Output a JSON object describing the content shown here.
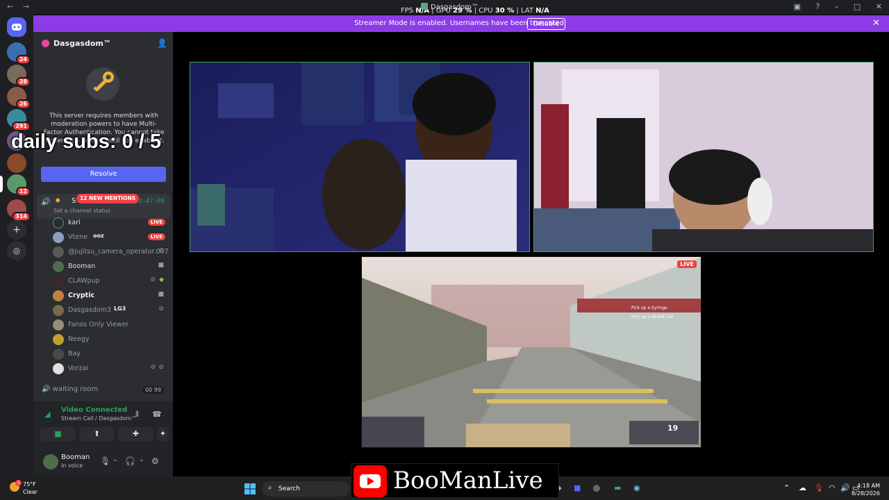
{
  "titlebar": {
    "nav_back": "←",
    "nav_forward": "→",
    "title": "Dasgasdom™",
    "stats": [
      {
        "label": "FPS",
        "value": "N/A"
      },
      {
        "label": "GPU",
        "value": "29 %"
      },
      {
        "label": "CPU",
        "value": "30 %"
      },
      {
        "label": "LAT",
        "value": "N/A"
      }
    ]
  },
  "banner": {
    "text": "Streamer Mode is enabled. Usernames have been truncated.",
    "button": "Disable"
  },
  "rail": {
    "badges": [
      "24",
      "28",
      "26",
      "291",
      "12",
      "314"
    ]
  },
  "server": {
    "name": "Dasgasdom™"
  },
  "mfa": {
    "text": "This server requires members with moderation powers to have Multi-Factor Authentication. You cannot take moderation actions until you enable it.",
    "button": "Resolve"
  },
  "overlay": {
    "daily_subs": "daily subs: 0 / 5"
  },
  "channel": {
    "name": "S",
    "timer": "53:47:09",
    "status": "Set a channel status",
    "mentions": "12 NEW MENTIONS"
  },
  "members": [
    {
      "name": "kari",
      "tag": "LIVE"
    },
    {
      "name": "Vtene",
      "suffix": "ooz",
      "tag": "LIVE"
    },
    {
      "name": "@jujitsu_camera_operator.007"
    },
    {
      "name": "Booman"
    },
    {
      "name": "CLAWpup"
    },
    {
      "name": "Cryptic"
    },
    {
      "name": "Dasgasdom3",
      "suffix": "LG3"
    },
    {
      "name": "Fanos Only Viewer"
    },
    {
      "name": "Neegy"
    },
    {
      "name": "Bay"
    },
    {
      "name": "Vorzai"
    }
  ],
  "waiting_room": {
    "name": "waiting room",
    "count": "00  99"
  },
  "voice": {
    "title": "Video Connected",
    "subtitle": "Stream Call / Dasgasdom™"
  },
  "user": {
    "name": "Booman",
    "status": "In voice"
  },
  "game": {
    "live": "LIVE",
    "prompt1": "Pick up a Syringe",
    "prompt2": "Pick up a Shield Cell",
    "ammo": "19"
  },
  "taskbar": {
    "temp": "75°F",
    "condition": "Clear",
    "weather_badge": "2",
    "search": "Search",
    "time": "4:18 AM",
    "date": "8/28/2026"
  },
  "youtube": {
    "channel": "BooManLive"
  }
}
